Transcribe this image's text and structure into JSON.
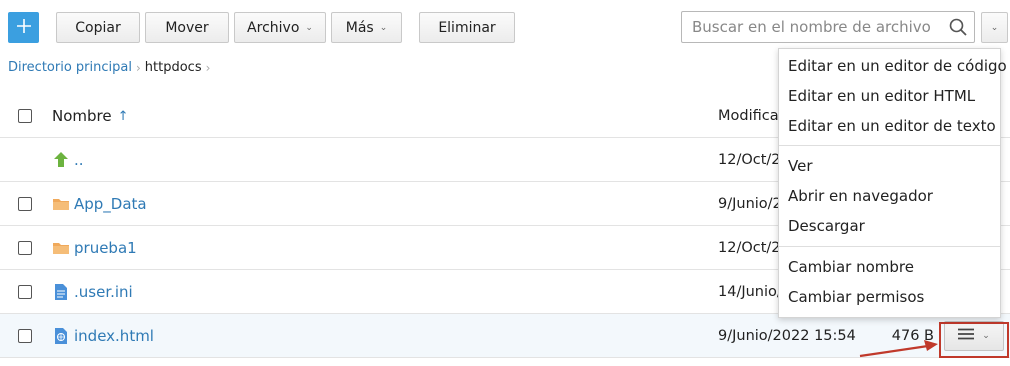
{
  "toolbar": {
    "add_icon": "plus-icon",
    "copy_label": "Copiar",
    "move_label": "Mover",
    "file_label": "Archivo",
    "more_label": "Más",
    "delete_label": "Eliminar",
    "search_placeholder": "Buscar en el nombre de archivo",
    "accent_color": "#3b9fe0"
  },
  "breadcrumb": {
    "root": "Directorio principal",
    "current": "httpdocs"
  },
  "table": {
    "columns": {
      "name": "Nombre",
      "sort_indicator": "↑",
      "modified": "Modificado"
    },
    "rows": [
      {
        "icon": "folder-up-icon",
        "name": "..",
        "modified": "12/Oct/2",
        "size": ""
      },
      {
        "icon": "folder-icon",
        "name": "App_Data",
        "modified": "9/Junio/2",
        "size": ""
      },
      {
        "icon": "folder-icon",
        "name": "prueba1",
        "modified": "12/Oct/2",
        "size": ""
      },
      {
        "icon": "text-file-icon",
        "name": ".user.ini",
        "modified": "14/Junio/",
        "size": ""
      },
      {
        "icon": "html-file-icon",
        "name": "index.html",
        "modified": "9/Junio/2022 15:54",
        "size": "476 B"
      }
    ]
  },
  "context_menu": {
    "items": [
      "Editar en un editor de código",
      "Editar en un editor HTML",
      "Editar en un editor de texto",
      "Ver",
      "Abrir en navegador",
      "Descargar",
      "Cambiar nombre",
      "Cambiar permisos"
    ]
  },
  "annotation_color": "#c0392b"
}
